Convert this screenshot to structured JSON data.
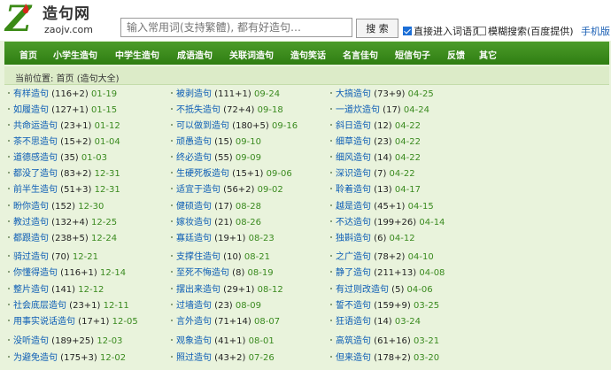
{
  "header": {
    "logo_z": "Z",
    "logo_cn": "造句网",
    "logo_domain": "zaojv.com",
    "search_placeholder": "输入常用词(支持繁體), 都有好造句…",
    "search_button": "搜 索",
    "option1": "直接进入词语页",
    "option1_checked": true,
    "option2": "模糊搜索(百度提供)",
    "option2_checked": false,
    "mobile": "手机版"
  },
  "nav": [
    "首页",
    "小学生造句",
    "中学生造句",
    "成语造句",
    "关联词造句",
    "造句笑话",
    "名言佳句",
    "短信句子",
    "反馈",
    "其它"
  ],
  "breadcrumb": "当前位置: 首页 (造句大全)",
  "columns": [
    [
      {
        "word": "有样造句",
        "count": "(116+2)",
        "date": "01-19"
      },
      {
        "word": "如履造句",
        "count": "(127+1)",
        "date": "01-15"
      },
      {
        "word": "共命运造句",
        "count": "(23+1)",
        "date": "01-12"
      },
      {
        "word": "茶不思造句",
        "count": "(15+2)",
        "date": "01-04"
      },
      {
        "word": "道德感造句",
        "count": "(35)",
        "date": "01-03"
      },
      {
        "word": "都没了造句",
        "count": "(83+2)",
        "date": "12-31"
      },
      {
        "word": "前半生造句",
        "count": "(51+3)",
        "date": "12-31"
      },
      {
        "word": "盼你造句",
        "count": "(152)",
        "date": "12-30"
      },
      {
        "word": "教过造句",
        "count": "(132+4)",
        "date": "12-25"
      },
      {
        "word": "都跟造句",
        "count": "(238+5)",
        "date": "12-24"
      },
      {
        "word": "骑过造句",
        "count": "(70)",
        "date": "12-21"
      },
      {
        "word": "你懂得造句",
        "count": "(116+1)",
        "date": "12-14"
      },
      {
        "word": "整片造句",
        "count": "(141)",
        "date": "12-12"
      },
      {
        "word": "社会底层造句",
        "count": "(23+1)",
        "date": "12-11"
      },
      {
        "word": "用事实说话造句",
        "count": "(17+1)",
        "date": "12-05"
      },
      {
        "word": "没听造句",
        "count": "(189+25)",
        "date": "12-03"
      },
      {
        "word": "为避免造句",
        "count": "(175+3)",
        "date": "12-02"
      }
    ],
    [
      {
        "word": "被剥造句",
        "count": "(111+1)",
        "date": "09-24"
      },
      {
        "word": "不抵失造句",
        "count": "(72+4)",
        "date": "09-18"
      },
      {
        "word": "可以做到造句",
        "count": "(180+5)",
        "date": "09-16"
      },
      {
        "word": "顽愚造句",
        "count": "(15)",
        "date": "09-10"
      },
      {
        "word": "终必造句",
        "count": "(55)",
        "date": "09-09"
      },
      {
        "word": "生硬死板造句",
        "count": "(15+1)",
        "date": "09-06"
      },
      {
        "word": "适宜于造句",
        "count": "(56+2)",
        "date": "09-02"
      },
      {
        "word": "健硕造句",
        "count": "(17)",
        "date": "08-28"
      },
      {
        "word": "嫁妆造句",
        "count": "(21)",
        "date": "08-26"
      },
      {
        "word": "寡廷造句",
        "count": "(19+1)",
        "date": "08-23"
      },
      {
        "word": "支撑住造句",
        "count": "(10)",
        "date": "08-21"
      },
      {
        "word": "至死不悔造句",
        "count": "(8)",
        "date": "08-19"
      },
      {
        "word": "摆出来造句",
        "count": "(29+1)",
        "date": "08-12"
      },
      {
        "word": "过墙造句",
        "count": "(23)",
        "date": "08-09"
      },
      {
        "word": "言外造句",
        "count": "(71+14)",
        "date": "08-07"
      },
      {
        "word": "观象造句",
        "count": "(41+1)",
        "date": "08-01"
      },
      {
        "word": "照过造句",
        "count": "(43+2)",
        "date": "07-26"
      }
    ],
    [
      {
        "word": "大搞造句",
        "count": "(73+9)",
        "date": "04-25"
      },
      {
        "word": "一道炊造句",
        "count": "(17)",
        "date": "04-24"
      },
      {
        "word": "斜日造句",
        "count": "(12)",
        "date": "04-22"
      },
      {
        "word": "细草造句",
        "count": "(23)",
        "date": "04-22"
      },
      {
        "word": "细风造句",
        "count": "(14)",
        "date": "04-22"
      },
      {
        "word": "深识造句",
        "count": "(7)",
        "date": "04-22"
      },
      {
        "word": "聆着造句",
        "count": "(13)",
        "date": "04-17"
      },
      {
        "word": "越是造句",
        "count": "(45+1)",
        "date": "04-15"
      },
      {
        "word": "不达造句",
        "count": "(199+26)",
        "date": "04-14"
      },
      {
        "word": "独斟造句",
        "count": "(6)",
        "date": "04-12"
      },
      {
        "word": "之广造句",
        "count": "(78+2)",
        "date": "04-10"
      },
      {
        "word": "静了造句",
        "count": "(211+13)",
        "date": "04-08"
      },
      {
        "word": "有过则改造句",
        "count": "(5)",
        "date": "04-06"
      },
      {
        "word": "誓不造句",
        "count": "(159+9)",
        "date": "03-25"
      },
      {
        "word": "狂语造句",
        "count": "(14)",
        "date": "03-24"
      },
      {
        "word": "高筑造句",
        "count": "(61+16)",
        "date": "03-21"
      },
      {
        "word": "但来造句",
        "count": "(178+2)",
        "date": "03-20"
      }
    ]
  ]
}
